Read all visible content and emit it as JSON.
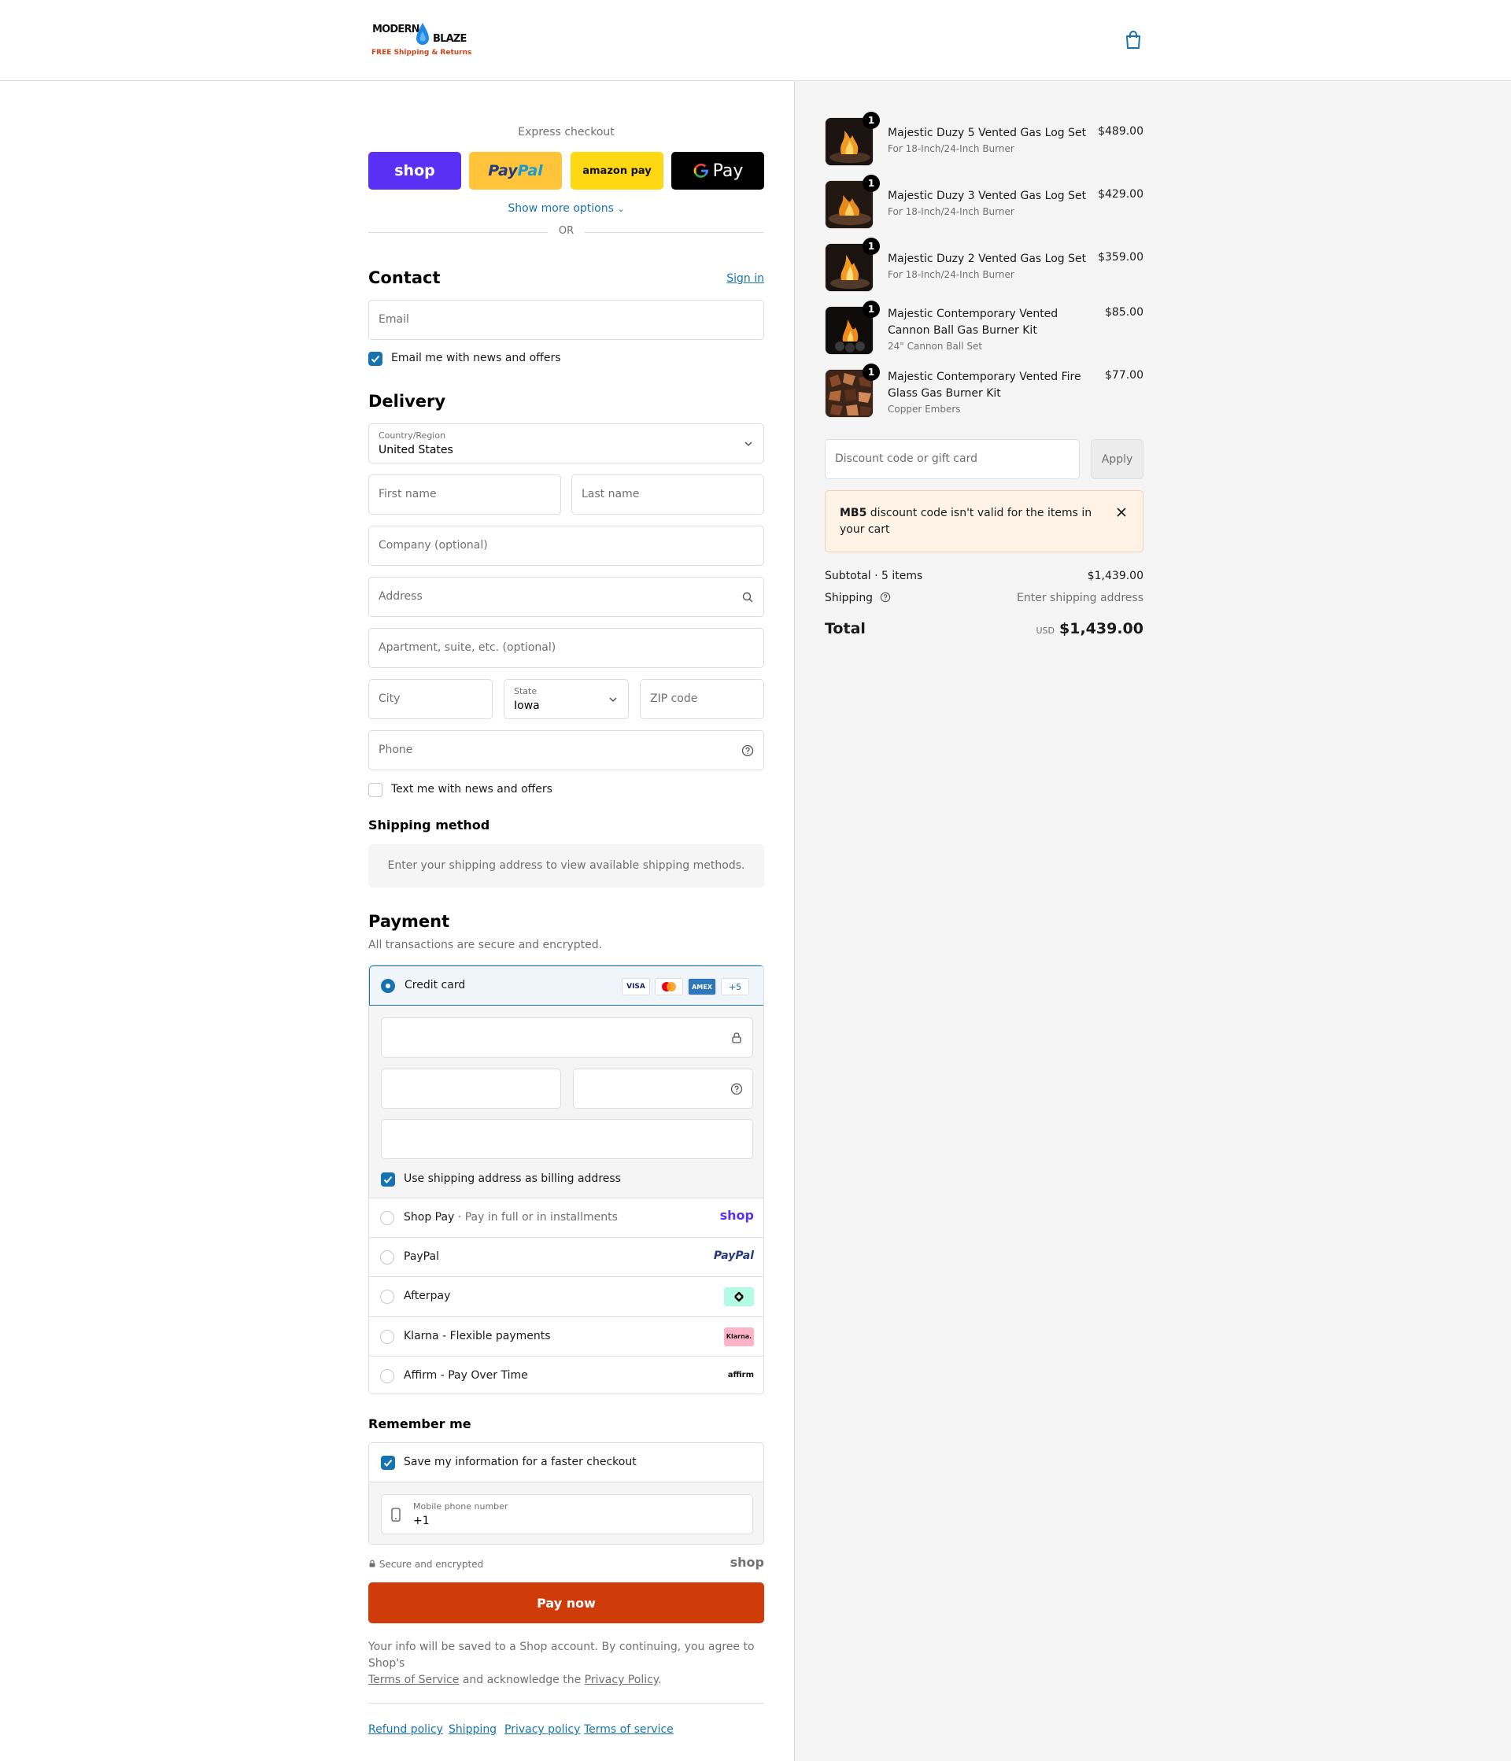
{
  "header": {
    "logo_line1": "MODERN",
    "logo_line2": "BLAZE",
    "logo_tag": "FREE Shipping & Returns"
  },
  "express": {
    "title": "Express checkout",
    "shop": "shop",
    "paypal_a": "Pay",
    "paypal_b": "Pal",
    "amazon": "amazon pay",
    "gpay": "Pay",
    "more": "Show more options",
    "or": "OR"
  },
  "contact": {
    "title": "Contact",
    "sign_in": "Sign in",
    "email_placeholder": "Email",
    "news_label": "Email me with news and offers"
  },
  "delivery": {
    "title": "Delivery",
    "country_label": "Country/Region",
    "country_value": "United States",
    "first_name": "First name",
    "last_name": "Last name",
    "company": "Company (optional)",
    "address": "Address",
    "apartment": "Apartment, suite, etc. (optional)",
    "city": "City",
    "state_label": "State",
    "state_value": "Iowa",
    "zip": "ZIP code",
    "phone": "Phone",
    "text_label": "Text me with news and offers"
  },
  "shipping_method": {
    "title": "Shipping method",
    "message": "Enter your shipping address to view available shipping methods."
  },
  "payment": {
    "title": "Payment",
    "subtitle": "All transactions are secure and encrypted.",
    "credit_card": "Credit card",
    "cards": [
      "VISA",
      "MC",
      "AMEX",
      "+5"
    ],
    "billing_label": "Use shipping address as billing address",
    "methods": [
      {
        "label": "Shop Pay",
        "sub": "Pay in full or in installments",
        "logo": "shop"
      },
      {
        "label": "PayPal",
        "sub": "",
        "logo": "PayPal"
      },
      {
        "label": "Afterpay",
        "sub": "",
        "logo": "afterpay"
      },
      {
        "label": "Klarna - Flexible payments",
        "sub": "",
        "logo": "Klarna."
      },
      {
        "label": "Affirm - Pay Over Time",
        "sub": "",
        "logo": "affirm"
      }
    ]
  },
  "remember": {
    "title": "Remember me",
    "save_label": "Save my information for a faster checkout",
    "mobile_label": "Mobile phone number",
    "mobile_value": "+1",
    "secure": "Secure and encrypted",
    "shop": "shop"
  },
  "pay_now": "Pay now",
  "legal": {
    "text1": "Your info will be saved to a Shop account. By continuing, you agree to Shop's",
    "terms": "Terms of Service",
    "text2": "and acknowledge the",
    "privacy": "Privacy Policy",
    "text3": "."
  },
  "footer": [
    "Refund policy",
    "Shipping",
    "Privacy policy",
    "Terms of service"
  ],
  "summary": {
    "items": [
      {
        "name": "Majestic Duzy 5 Vented Gas Log Set",
        "variant": "For 18-Inch/24-Inch Burner",
        "price": "$489.00",
        "qty": "1"
      },
      {
        "name": "Majestic Duzy 3 Vented Gas Log Set",
        "variant": "For 18-Inch/24-Inch Burner",
        "price": "$429.00",
        "qty": "1"
      },
      {
        "name": "Majestic Duzy 2 Vented Gas Log Set",
        "variant": "For 18-Inch/24-Inch Burner",
        "price": "$359.00",
        "qty": "1"
      },
      {
        "name": "Majestic Contemporary Vented Cannon Ball Gas Burner Kit",
        "variant": "24\" Cannon Ball Set",
        "price": "$85.00",
        "qty": "1"
      },
      {
        "name": "Majestic Contemporary Vented Fire Glass Gas Burner Kit",
        "variant": "Copper Embers",
        "price": "$77.00",
        "qty": "1"
      }
    ],
    "discount_placeholder": "Discount code or gift card",
    "apply": "Apply",
    "alert_code": "MB5",
    "alert_text": "discount code isn't valid for the items in your cart",
    "subtotal_label": "Subtotal · 5 items",
    "subtotal_value": "$1,439.00",
    "shipping_label": "Shipping",
    "shipping_value": "Enter shipping address",
    "total_label": "Total",
    "currency": "USD",
    "total_value": "$1,439.00"
  },
  "colors": {
    "accent": "#1773b0",
    "pay_button": "#d03b0a",
    "shop_purple": "#5a31f4",
    "paypal_yellow": "#ffc439",
    "amazon_yellow": "#ffd814"
  }
}
